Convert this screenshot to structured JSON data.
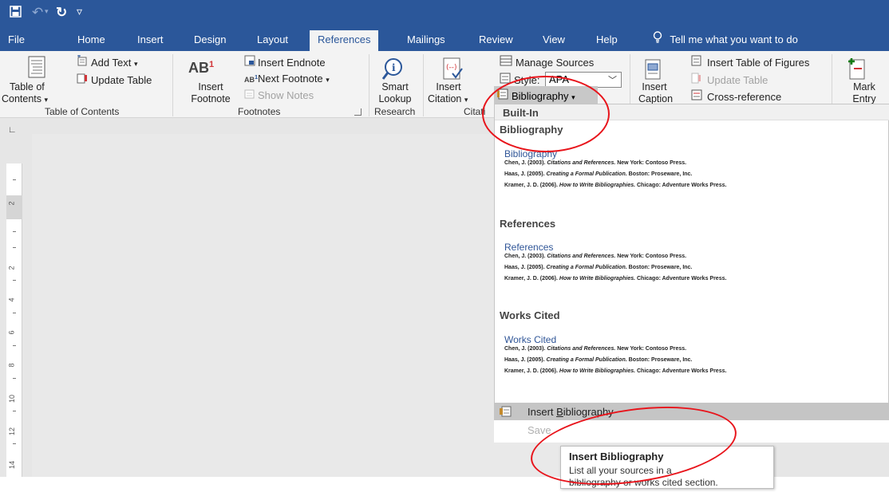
{
  "quick_access": {
    "save_icon": "save-icon",
    "undo_icon": "undo-icon",
    "redo_icon": "redo-icon",
    "customize_icon": "customize-toolbar-icon"
  },
  "tabs": [
    "File",
    "Home",
    "Insert",
    "Design",
    "Layout",
    "References",
    "Mailings",
    "Review",
    "View",
    "Help"
  ],
  "active_tab": "References",
  "tell_me": "Tell me what you want to do",
  "ribbon": {
    "toc": {
      "big_label_1": "Table of",
      "big_label_2": "Contents",
      "add_text": "Add Text",
      "update_table": "Update Table",
      "group": "Table of Contents"
    },
    "footnotes": {
      "ab_text": "AB",
      "insert_label_1": "Insert",
      "insert_label_2": "Footnote",
      "insert_endnote": "Insert Endnote",
      "next_footnote": "Next Footnote",
      "show_notes": "Show Notes",
      "group": "Footnotes"
    },
    "research": {
      "label_1": "Smart",
      "label_2": "Lookup",
      "group": "Research"
    },
    "citations": {
      "label_1": "Insert",
      "label_2": "Citation",
      "manage_sources": "Manage Sources",
      "style_label": "Style:",
      "style_value": "APA",
      "bibliography": "Bibliography",
      "group": "Citati"
    },
    "captions": {
      "label_1": "Insert",
      "label_2": "Caption",
      "insert_table_of_figures": "Insert Table of Figures",
      "update_table": "Update Table",
      "cross_reference": "Cross-reference"
    },
    "index": {
      "label_1": "Mark",
      "label_2": "Entry"
    }
  },
  "ruler_numbers": [
    "2",
    "2",
    "4",
    "6",
    "8",
    "10",
    "12",
    "14"
  ],
  "gallery": {
    "header": "Built-In",
    "sections": [
      {
        "category": "Bibliography",
        "title": "Bibliography",
        "refs": [
          {
            "author": "Chen, J. (2003).",
            "title": "Citations and References.",
            "rest": "New York: Contoso Press."
          },
          {
            "author": "Haas, J. (2005).",
            "title": "Creating a Formal Publication.",
            "rest": "Boston: Proseware, Inc."
          },
          {
            "author": "Kramer, J. D. (2006).",
            "title": "How to Write Bibliographies.",
            "rest": "Chicago: Adventure Works Press."
          }
        ]
      },
      {
        "category": "References",
        "title": "References",
        "refs": [
          {
            "author": "Chen, J. (2003).",
            "title": "Citations and References.",
            "rest": "New York: Contoso Press."
          },
          {
            "author": "Haas, J. (2005).",
            "title": "Creating a Formal Publication.",
            "rest": "Boston: Proseware, Inc."
          },
          {
            "author": "Kramer, J. D. (2006).",
            "title": "How to Write Bibliographies.",
            "rest": "Chicago: Adventure Works Press."
          }
        ]
      },
      {
        "category": "Works Cited",
        "title": "Works Cited",
        "refs": [
          {
            "author": "Chen, J. (2003).",
            "title": "Citations and References.",
            "rest": "New York: Contoso Press."
          },
          {
            "author": "Haas, J. (2005).",
            "title": "Creating a Formal Publication.",
            "rest": "Boston: Proseware, Inc."
          },
          {
            "author": "Kramer, J. D. (2006).",
            "title": "How to Write Bibliographies.",
            "rest": "Chicago: Adventure Works Press."
          }
        ]
      }
    ]
  },
  "menu": {
    "insert_bibliography_pre": "Insert ",
    "insert_bibliography_u": "B",
    "insert_bibliography_post": "ibliography",
    "save_partial": "Save"
  },
  "tooltip": {
    "title": "Insert Bibliography",
    "line1": "List all your sources in a",
    "line2": "bibliography or works cited section."
  },
  "colors": {
    "accent": "#2b579a",
    "annotation_circle": "#e8141b"
  }
}
